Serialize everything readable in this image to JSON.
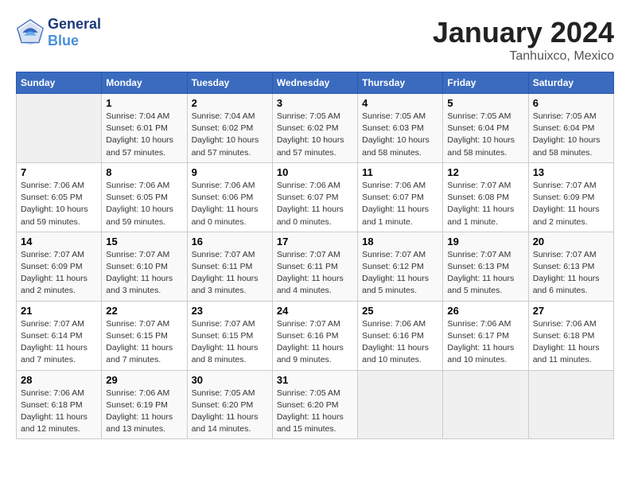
{
  "header": {
    "logo_line1": "General",
    "logo_line2": "Blue",
    "month": "January 2024",
    "location": "Tanhuixco, Mexico"
  },
  "columns": [
    "Sunday",
    "Monday",
    "Tuesday",
    "Wednesday",
    "Thursday",
    "Friday",
    "Saturday"
  ],
  "weeks": [
    [
      {
        "day": "",
        "sunrise": "",
        "sunset": "",
        "daylight": "",
        "empty": true
      },
      {
        "day": "1",
        "sunrise": "Sunrise: 7:04 AM",
        "sunset": "Sunset: 6:01 PM",
        "daylight": "Daylight: 10 hours and 57 minutes."
      },
      {
        "day": "2",
        "sunrise": "Sunrise: 7:04 AM",
        "sunset": "Sunset: 6:02 PM",
        "daylight": "Daylight: 10 hours and 57 minutes."
      },
      {
        "day": "3",
        "sunrise": "Sunrise: 7:05 AM",
        "sunset": "Sunset: 6:02 PM",
        "daylight": "Daylight: 10 hours and 57 minutes."
      },
      {
        "day": "4",
        "sunrise": "Sunrise: 7:05 AM",
        "sunset": "Sunset: 6:03 PM",
        "daylight": "Daylight: 10 hours and 58 minutes."
      },
      {
        "day": "5",
        "sunrise": "Sunrise: 7:05 AM",
        "sunset": "Sunset: 6:04 PM",
        "daylight": "Daylight: 10 hours and 58 minutes."
      },
      {
        "day": "6",
        "sunrise": "Sunrise: 7:05 AM",
        "sunset": "Sunset: 6:04 PM",
        "daylight": "Daylight: 10 hours and 58 minutes."
      }
    ],
    [
      {
        "day": "7",
        "sunrise": "Sunrise: 7:06 AM",
        "sunset": "Sunset: 6:05 PM",
        "daylight": "Daylight: 10 hours and 59 minutes."
      },
      {
        "day": "8",
        "sunrise": "Sunrise: 7:06 AM",
        "sunset": "Sunset: 6:05 PM",
        "daylight": "Daylight: 10 hours and 59 minutes."
      },
      {
        "day": "9",
        "sunrise": "Sunrise: 7:06 AM",
        "sunset": "Sunset: 6:06 PM",
        "daylight": "Daylight: 11 hours and 0 minutes."
      },
      {
        "day": "10",
        "sunrise": "Sunrise: 7:06 AM",
        "sunset": "Sunset: 6:07 PM",
        "daylight": "Daylight: 11 hours and 0 minutes."
      },
      {
        "day": "11",
        "sunrise": "Sunrise: 7:06 AM",
        "sunset": "Sunset: 6:07 PM",
        "daylight": "Daylight: 11 hours and 1 minute."
      },
      {
        "day": "12",
        "sunrise": "Sunrise: 7:07 AM",
        "sunset": "Sunset: 6:08 PM",
        "daylight": "Daylight: 11 hours and 1 minute."
      },
      {
        "day": "13",
        "sunrise": "Sunrise: 7:07 AM",
        "sunset": "Sunset: 6:09 PM",
        "daylight": "Daylight: 11 hours and 2 minutes."
      }
    ],
    [
      {
        "day": "14",
        "sunrise": "Sunrise: 7:07 AM",
        "sunset": "Sunset: 6:09 PM",
        "daylight": "Daylight: 11 hours and 2 minutes."
      },
      {
        "day": "15",
        "sunrise": "Sunrise: 7:07 AM",
        "sunset": "Sunset: 6:10 PM",
        "daylight": "Daylight: 11 hours and 3 minutes."
      },
      {
        "day": "16",
        "sunrise": "Sunrise: 7:07 AM",
        "sunset": "Sunset: 6:11 PM",
        "daylight": "Daylight: 11 hours and 3 minutes."
      },
      {
        "day": "17",
        "sunrise": "Sunrise: 7:07 AM",
        "sunset": "Sunset: 6:11 PM",
        "daylight": "Daylight: 11 hours and 4 minutes."
      },
      {
        "day": "18",
        "sunrise": "Sunrise: 7:07 AM",
        "sunset": "Sunset: 6:12 PM",
        "daylight": "Daylight: 11 hours and 5 minutes."
      },
      {
        "day": "19",
        "sunrise": "Sunrise: 7:07 AM",
        "sunset": "Sunset: 6:13 PM",
        "daylight": "Daylight: 11 hours and 5 minutes."
      },
      {
        "day": "20",
        "sunrise": "Sunrise: 7:07 AM",
        "sunset": "Sunset: 6:13 PM",
        "daylight": "Daylight: 11 hours and 6 minutes."
      }
    ],
    [
      {
        "day": "21",
        "sunrise": "Sunrise: 7:07 AM",
        "sunset": "Sunset: 6:14 PM",
        "daylight": "Daylight: 11 hours and 7 minutes."
      },
      {
        "day": "22",
        "sunrise": "Sunrise: 7:07 AM",
        "sunset": "Sunset: 6:15 PM",
        "daylight": "Daylight: 11 hours and 7 minutes."
      },
      {
        "day": "23",
        "sunrise": "Sunrise: 7:07 AM",
        "sunset": "Sunset: 6:15 PM",
        "daylight": "Daylight: 11 hours and 8 minutes."
      },
      {
        "day": "24",
        "sunrise": "Sunrise: 7:07 AM",
        "sunset": "Sunset: 6:16 PM",
        "daylight": "Daylight: 11 hours and 9 minutes."
      },
      {
        "day": "25",
        "sunrise": "Sunrise: 7:06 AM",
        "sunset": "Sunset: 6:16 PM",
        "daylight": "Daylight: 11 hours and 10 minutes."
      },
      {
        "day": "26",
        "sunrise": "Sunrise: 7:06 AM",
        "sunset": "Sunset: 6:17 PM",
        "daylight": "Daylight: 11 hours and 10 minutes."
      },
      {
        "day": "27",
        "sunrise": "Sunrise: 7:06 AM",
        "sunset": "Sunset: 6:18 PM",
        "daylight": "Daylight: 11 hours and 11 minutes."
      }
    ],
    [
      {
        "day": "28",
        "sunrise": "Sunrise: 7:06 AM",
        "sunset": "Sunset: 6:18 PM",
        "daylight": "Daylight: 11 hours and 12 minutes."
      },
      {
        "day": "29",
        "sunrise": "Sunrise: 7:06 AM",
        "sunset": "Sunset: 6:19 PM",
        "daylight": "Daylight: 11 hours and 13 minutes."
      },
      {
        "day": "30",
        "sunrise": "Sunrise: 7:05 AM",
        "sunset": "Sunset: 6:20 PM",
        "daylight": "Daylight: 11 hours and 14 minutes."
      },
      {
        "day": "31",
        "sunrise": "Sunrise: 7:05 AM",
        "sunset": "Sunset: 6:20 PM",
        "daylight": "Daylight: 11 hours and 15 minutes."
      },
      {
        "day": "",
        "sunrise": "",
        "sunset": "",
        "daylight": "",
        "empty": true
      },
      {
        "day": "",
        "sunrise": "",
        "sunset": "",
        "daylight": "",
        "empty": true
      },
      {
        "day": "",
        "sunrise": "",
        "sunset": "",
        "daylight": "",
        "empty": true
      }
    ]
  ]
}
